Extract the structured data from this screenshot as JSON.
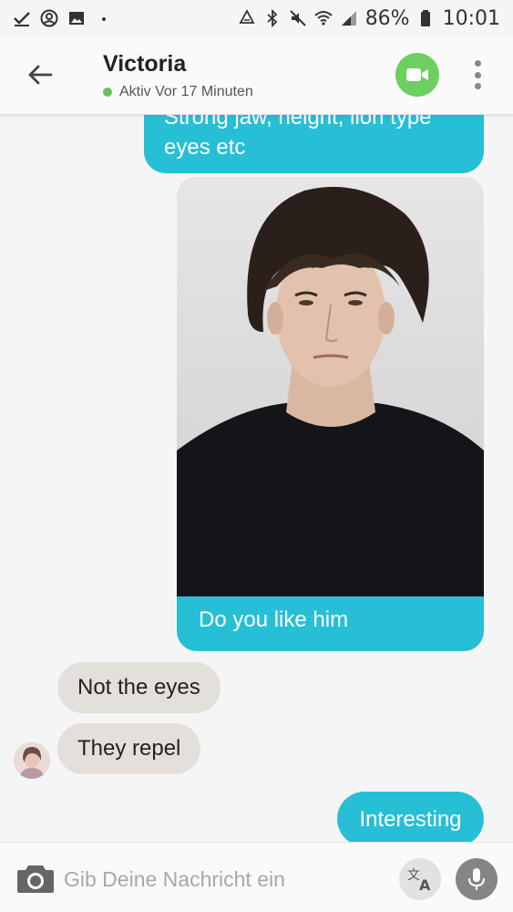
{
  "status_bar": {
    "battery": "86%",
    "time": "10:01",
    "left_icons": [
      "check-icon",
      "account-circle-icon",
      "image-icon",
      "dot-icon"
    ],
    "right_icons": [
      "recycle-icon",
      "bluetooth-icon",
      "mute-icon",
      "wifi-icon",
      "signal-icon",
      "battery-icon"
    ]
  },
  "header": {
    "contact_name": "Victoria",
    "status": "Aktiv Vor 17 Minuten",
    "online_color": "#66c25a",
    "video_button_color": "#6ccf5f"
  },
  "messages": [
    {
      "from": "me",
      "line1": "Strong jaw, height, lion type",
      "line2": "eyes etc"
    },
    {
      "from": "me",
      "type": "photo",
      "caption": "Do you like him"
    },
    {
      "from": "them",
      "text": "Not the eyes"
    },
    {
      "from": "them",
      "text": "They repel"
    },
    {
      "from": "me",
      "text": "Interesting"
    }
  ],
  "composer": {
    "placeholder": "Gib Deine Nachricht ein"
  },
  "colors": {
    "outgoing_bubble": "#27bfd6",
    "incoming_bubble": "#e3e0dc",
    "background": "#f5f5f5"
  }
}
